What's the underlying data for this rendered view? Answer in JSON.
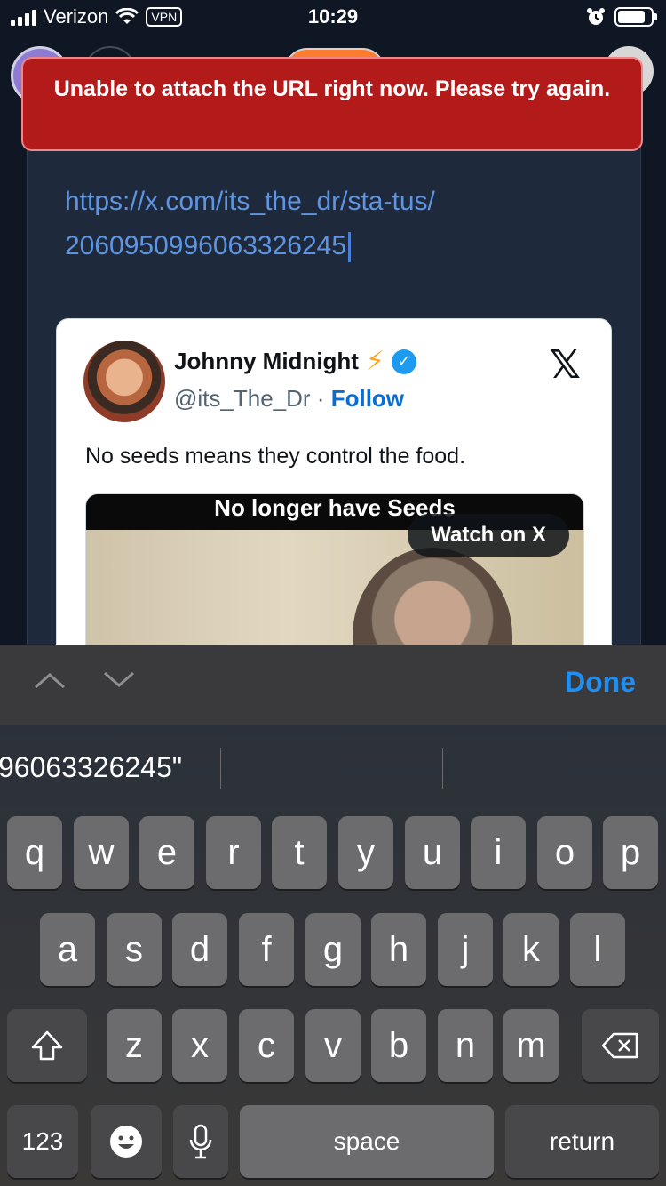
{
  "status_bar": {
    "carrier": "Verizon",
    "vpn": "VPN",
    "time": "10:29"
  },
  "toast": {
    "message": "Unable to attach the URL right now. Please try again.",
    "color": "#b31b1b"
  },
  "editor": {
    "url_text": "https://x.com/its_the_dr/sta-tus/2060950996063326245"
  },
  "tweet": {
    "name": "Johnny Midnight",
    "handle": "@its_The_Dr",
    "separator": "·",
    "follow": "Follow",
    "x_logo": "𝕏",
    "text": "No seeds means they control the food.",
    "media_caption": "No longer have Seeds",
    "watch_button": "Watch on X"
  },
  "accessory_bar": {
    "done": "Done"
  },
  "keyboard": {
    "suggestion": "96063326245\"",
    "row1": [
      "q",
      "w",
      "e",
      "r",
      "t",
      "y",
      "u",
      "i",
      "o",
      "p"
    ],
    "row2": [
      "a",
      "s",
      "d",
      "f",
      "g",
      "h",
      "j",
      "k",
      "l"
    ],
    "row3": [
      "z",
      "x",
      "c",
      "v",
      "b",
      "n",
      "m"
    ],
    "numbers_key": "123",
    "space_key": "space",
    "return_key": "return"
  }
}
